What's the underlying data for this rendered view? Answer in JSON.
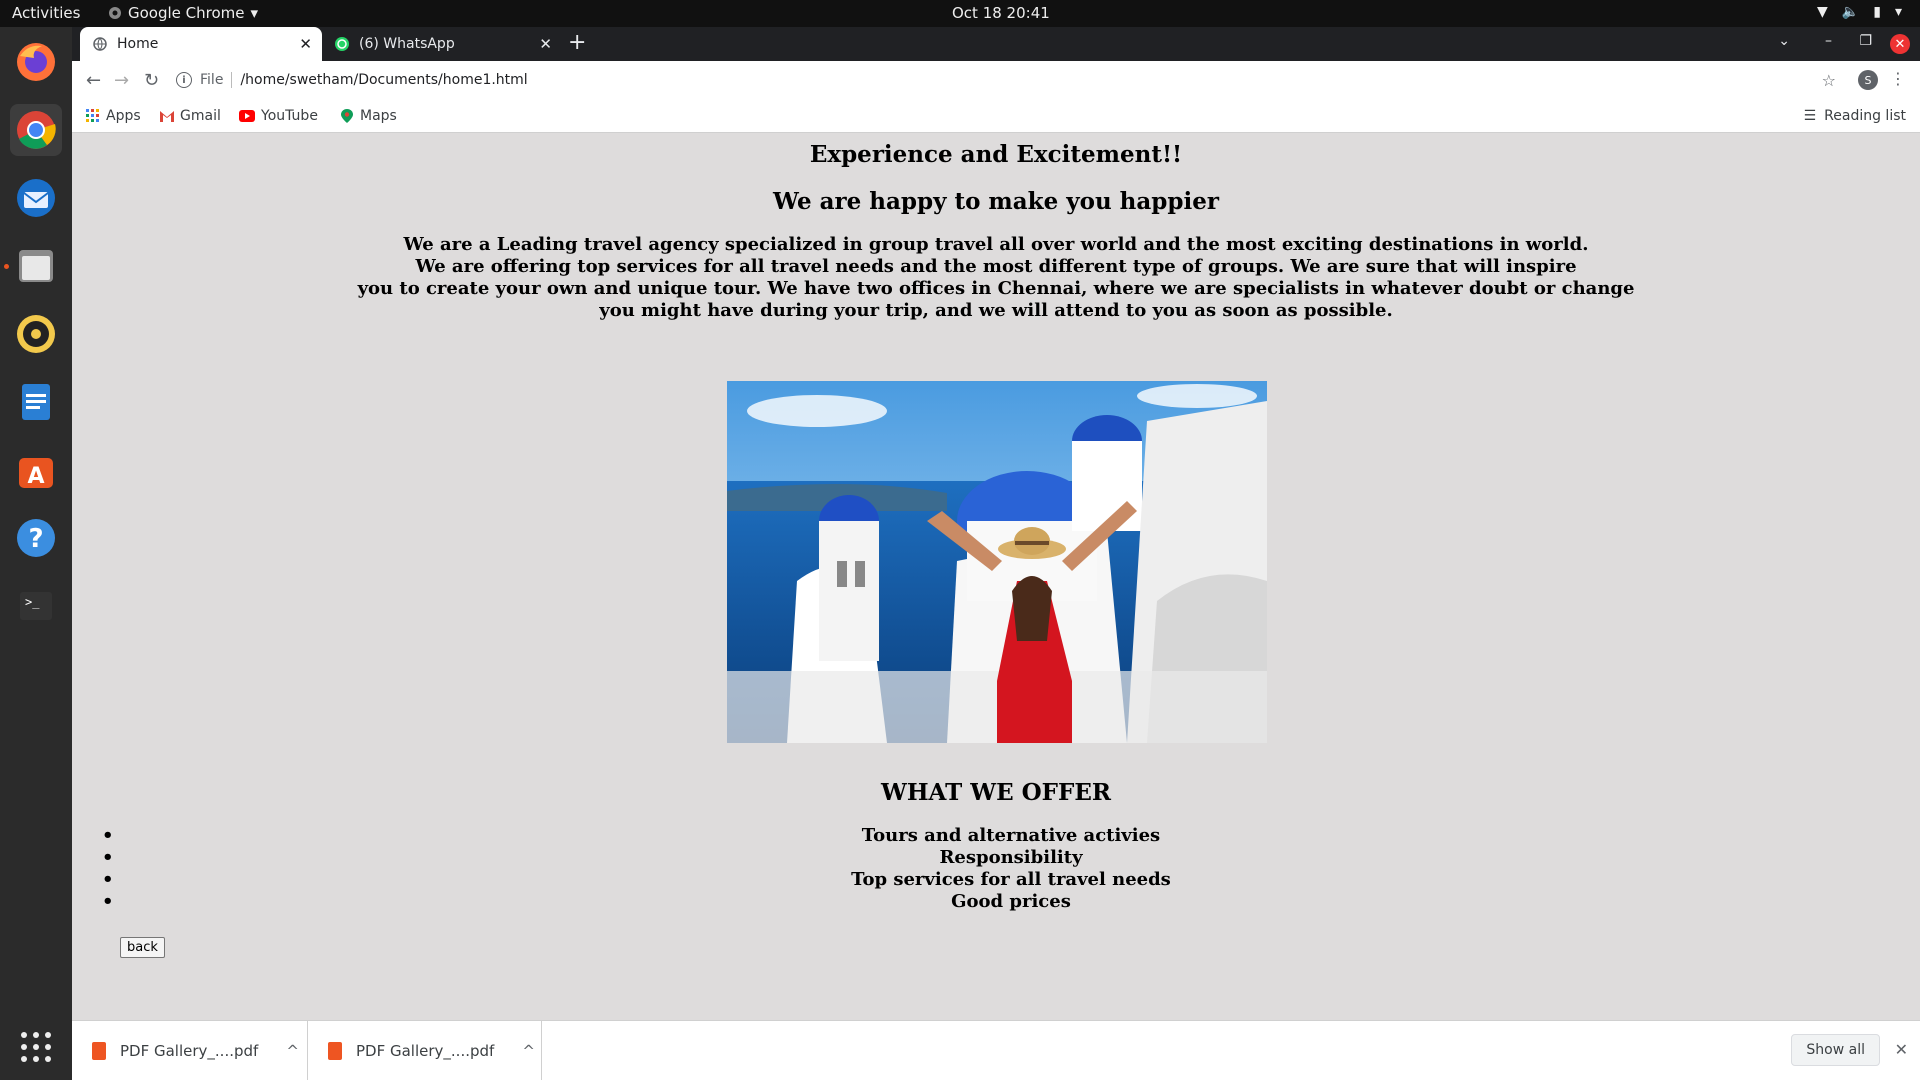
{
  "topbar": {
    "activities": "Activities",
    "app_name": "Google Chrome",
    "clock": "Oct 18  20:41"
  },
  "dock": {
    "items": [
      "firefox-icon",
      "chrome-icon",
      "thunderbird-icon",
      "files-icon",
      "rhythmbox-icon",
      "writer-icon",
      "software-icon",
      "help-icon",
      "terminal-icon",
      "app-grid-icon"
    ]
  },
  "tabs": [
    {
      "label": "Home",
      "active": true
    },
    {
      "label": "(6) WhatsApp",
      "active": false
    }
  ],
  "address": {
    "scheme": "File",
    "url": "/home/swetham/Documents/home1.html"
  },
  "profile_initial": "S",
  "bookmarks": {
    "items": [
      "Apps",
      "Gmail",
      "YouTube",
      "Maps"
    ],
    "reading_list": "Reading list"
  },
  "page": {
    "heading1": "Experience and Excitement!!",
    "heading2": "We are happy to make you happier",
    "intro_lines": [
      "We are a Leading travel agency specialized in group travel all over world and the most exciting destinations in world.",
      "We are offering top services for all travel needs and the most different type of groups. We are sure that will inspire",
      "you to create your own and unique tour. We have two offices in Chennai, where we are specialists in whatever doubt or change",
      "you might have during your trip, and we will attend to you as soon as possible."
    ],
    "offer_heading": "WHAT WE OFFER",
    "offers": [
      "Tours and alternative activies",
      "Responsibility",
      "Top services for all travel needs",
      "Good prices"
    ],
    "back_label": "back"
  },
  "downloads": {
    "items": [
      "PDF Gallery_....pdf",
      "PDF Gallery_....pdf"
    ],
    "show_all": "Show all"
  },
  "colors": {
    "page_background": "#dedcdc",
    "ubuntu_orange": "#e95420",
    "close_red": "#e33333"
  }
}
